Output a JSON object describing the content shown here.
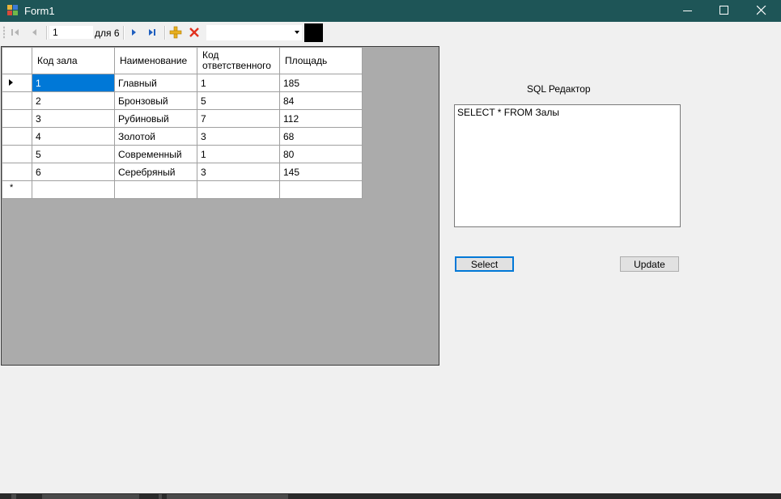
{
  "window": {
    "title": "Form1"
  },
  "navigator": {
    "position": "1",
    "count_label": "для 6"
  },
  "grid": {
    "columns": [
      "Код зала",
      "Наименование",
      "Код ответственного",
      "Площадь"
    ],
    "rows": [
      [
        "1",
        "Главный",
        "1",
        "185"
      ],
      [
        "2",
        "Бронзовый",
        "5",
        "84"
      ],
      [
        "3",
        "Рубиновый",
        "7",
        "112"
      ],
      [
        "4",
        "Золотой",
        "3",
        "68"
      ],
      [
        "5",
        "Современный",
        "1",
        "80"
      ],
      [
        "6",
        "Серебряный",
        "3",
        "145"
      ]
    ],
    "new_row_marker": "*"
  },
  "sql_editor": {
    "label": "SQL Редактор",
    "query": "SELECT * FROM Залы"
  },
  "buttons": {
    "select_label": "Select",
    "update_label": "Update"
  },
  "colors": {
    "titlebar": "#1e5557",
    "selection": "#0078d7",
    "grid_background": "#ababab"
  }
}
